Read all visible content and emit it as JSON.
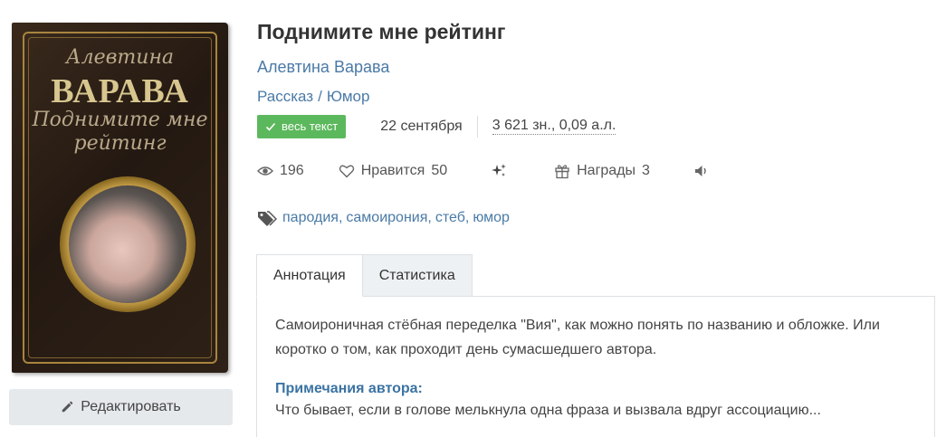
{
  "cover": {
    "author_script": "Алевтина",
    "surname": "ВАРАВА",
    "title_script": "Поднимите мне рейтинг"
  },
  "edit_button_label": "Редактировать",
  "work": {
    "title": "Поднимите мне рейтинг",
    "author": "Алевтина Варава",
    "genres": [
      "Рассказ",
      "Юмор"
    ],
    "badge": "весь текст",
    "date": "22 сентября",
    "size": "3 621 зн., 0,09 а.л."
  },
  "stats": {
    "views": "196",
    "likes_label": "Нравится",
    "likes": "50",
    "awards_label": "Награды",
    "awards": "3"
  },
  "tags": [
    "пародия",
    "самоирония",
    "стеб",
    "юмор"
  ],
  "tabs": [
    "Аннотация",
    "Статистика"
  ],
  "annotation": {
    "text": "Самоироничная стёбная переделка \"Вия\", как можно понять по названию и обложке. Или коротко о том, как проходит день сумасшедшего автора.",
    "notes_title": "Примечания автора:",
    "notes_text": "Что бывает, если в голове мелькнула одна фраза и вызвала вдруг ассоциацию..."
  },
  "icons": {
    "edit": "pencil-icon",
    "badge": "check-icon",
    "views": "eye-icon",
    "likes": "heart-icon",
    "rate": "sparkles-icon",
    "awards": "gift-icon",
    "audio": "speaker-icon",
    "tags": "tags-icon"
  },
  "colors": {
    "link": "#4a7aa6",
    "badge_bg": "#5cb85c",
    "notes_title": "#3b73a3"
  }
}
